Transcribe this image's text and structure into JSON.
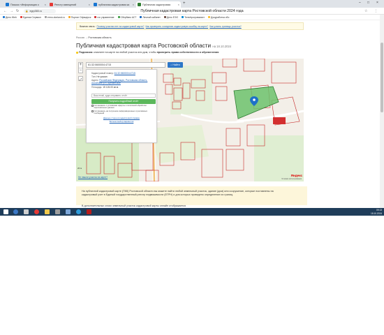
{
  "browser": {
    "tabs": [
      {
        "title": "Письмо «Информация о",
        "color": "#1976d2"
      },
      {
        "title": "Реестр извещений",
        "color": "#e53935"
      },
      {
        "title": "публичная кадастровая ка",
        "color": "#1976d2"
      },
      {
        "title": "Публичная кадастровая",
        "color": "#2e7d32",
        "active": true
      }
    ],
    "window_title": "Публичная кадастровая карта Ростовской области 2024 года",
    "url": "egrp365.ru",
    "bookmarks": [
      {
        "label": "Дело Web",
        "color": "#1976d2"
      },
      {
        "label": "Единая Сервисн",
        "color": "#e53935"
      },
      {
        "label": "ermo.donland.ru",
        "color": "#9e9e9e"
      },
      {
        "label": "Портал Офицерск",
        "color": "#f9a825"
      },
      {
        "label": "гос управление",
        "color": "#d32f2f"
      },
      {
        "label": "Сбербанк АСТ",
        "color": "#43a047"
      },
      {
        "label": "Личный кабинет",
        "color": "#1565c0"
      },
      {
        "label": "Дело ЕЭО",
        "color": "#6d4c41"
      },
      {
        "label": "Теле/программист",
        "color": "#0288d1"
      },
      {
        "label": "Докуработка сбо",
        "color": "#fbc02d"
      }
    ]
  },
  "notice": {
    "label": "Важная связь:",
    "link1": "Почему участки нет на кадастровой карте?",
    "link2": "Как проверить соседнюю кадастровую ошибку на карте?",
    "link3": "Как узнать границы участка?"
  },
  "breadcrumb": {
    "root": "Россия",
    "sep": "→",
    "current": "Ростовская область"
  },
  "page": {
    "title": "Публичная кадастровая карта Ростовской области",
    "title_date": "на 18.10.2024",
    "hint_label": "Подсказка:",
    "hint_text": "кликните на карте на любой участок или дом, чтобы",
    "hint_bold": "проверить права собственности и обременения"
  },
  "map": {
    "search_value": "61:32:0600004:4715",
    "search_button": "Найти",
    "card": {
      "kad_label": "Кадастровый номер:",
      "kad_value": "61:32:0600004:4715",
      "type_label": "Тип:",
      "type_value": "Не указан",
      "addr_label": "Адрес:",
      "addr_value": "Российская Федерация, Ростовская область, Аксайский р-н, Щепкинское",
      "area_label": "Площадь:",
      "area_value": "15 126.00 кв.м.",
      "email_placeholder": "Ваш email, куда отправить отчёт",
      "get_report": "Получить подробный отчёт",
      "chk1": "Соглашаюсь с условиями оферты и политикой обработки персональных данных",
      "chk2": "Соглашаюсь на получение информационных и рекламных сообщений",
      "link_cadastr": "Данные сторон в кадастровой справке",
      "link_more": "Больше выбор вариантов"
    },
    "not_found": "Не нашли участок на карте?",
    "yandex": "Яндекс",
    "yandex_sub": "Условия использования",
    "scale": "20 м"
  },
  "info": {
    "p1": "На публичной кадастровой карте (ПКК) Ростовской области вы можете найти любой земельный участок, здание (дом) или сооружение, которые поставлены на",
    "p2": "кадастровый учет в Единый государственный реестр недвижимости (ЕГРН) и для которых проведено определение их границ.",
    "below": "В дополнительных слоях земельный участок кадастровой карты онлайн отображается"
  },
  "taskbar": {
    "time": "09:13",
    "date": "18.10.2024",
    "apps": [
      "#ffffff",
      "#3b78c6",
      "#cfcfcf",
      "#e53935",
      "#f2c94c",
      "#9e9e9e",
      "#7da7d9",
      "#2e9cdb",
      "#b71c1c"
    ]
  }
}
